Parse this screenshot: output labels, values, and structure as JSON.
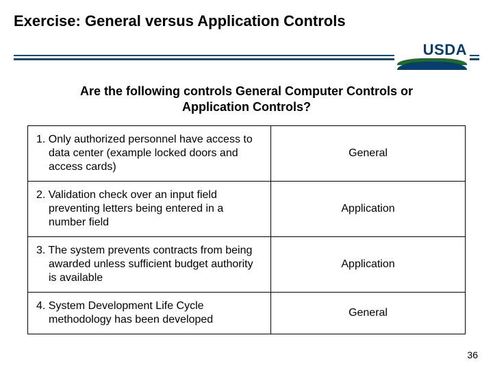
{
  "title": "Exercise:  General versus Application Controls",
  "logo_text": "USDA",
  "question": "Are the following controls General Computer Controls or Application Controls?",
  "rows": [
    {
      "desc": "1. Only authorized personnel have access to data center (example locked doors and access cards)",
      "answer": "General"
    },
    {
      "desc": "2. Validation check over an input field preventing letters being entered in a number field",
      "answer": "Application"
    },
    {
      "desc": "3. The system prevents contracts from being awarded unless sufficient budget authority is available",
      "answer": "Application"
    },
    {
      "desc": "4. System Development Life Cycle methodology has been developed",
      "answer": "General"
    }
  ],
  "page_number": "36"
}
